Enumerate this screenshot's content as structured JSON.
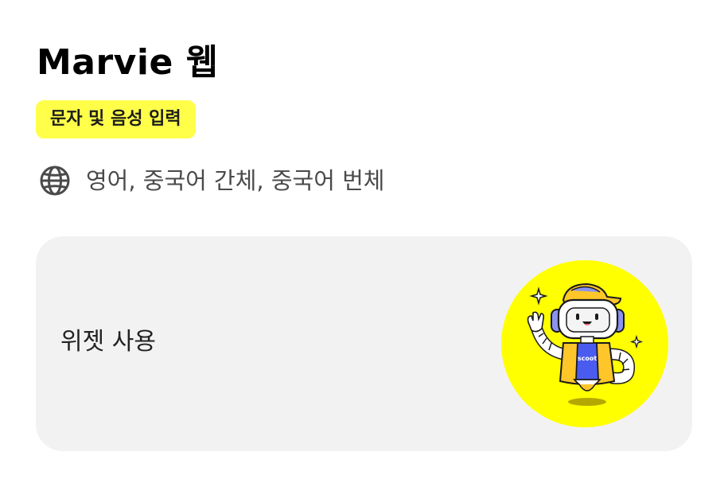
{
  "header": {
    "title": "Marvie 웹"
  },
  "badge": {
    "label": "문자 및 음성 입력"
  },
  "languages": {
    "icon": "globe-icon",
    "text": "영어, 중국어 간체, 중국어 번체"
  },
  "widget": {
    "label": "위젯 사용",
    "mascot_text": "scoot"
  },
  "colors": {
    "badge_bg": "#ffff4a",
    "card_bg": "#f2f2f2",
    "mascot_circle": "#ffff00",
    "mascot_accent": "#4a5cf0"
  }
}
